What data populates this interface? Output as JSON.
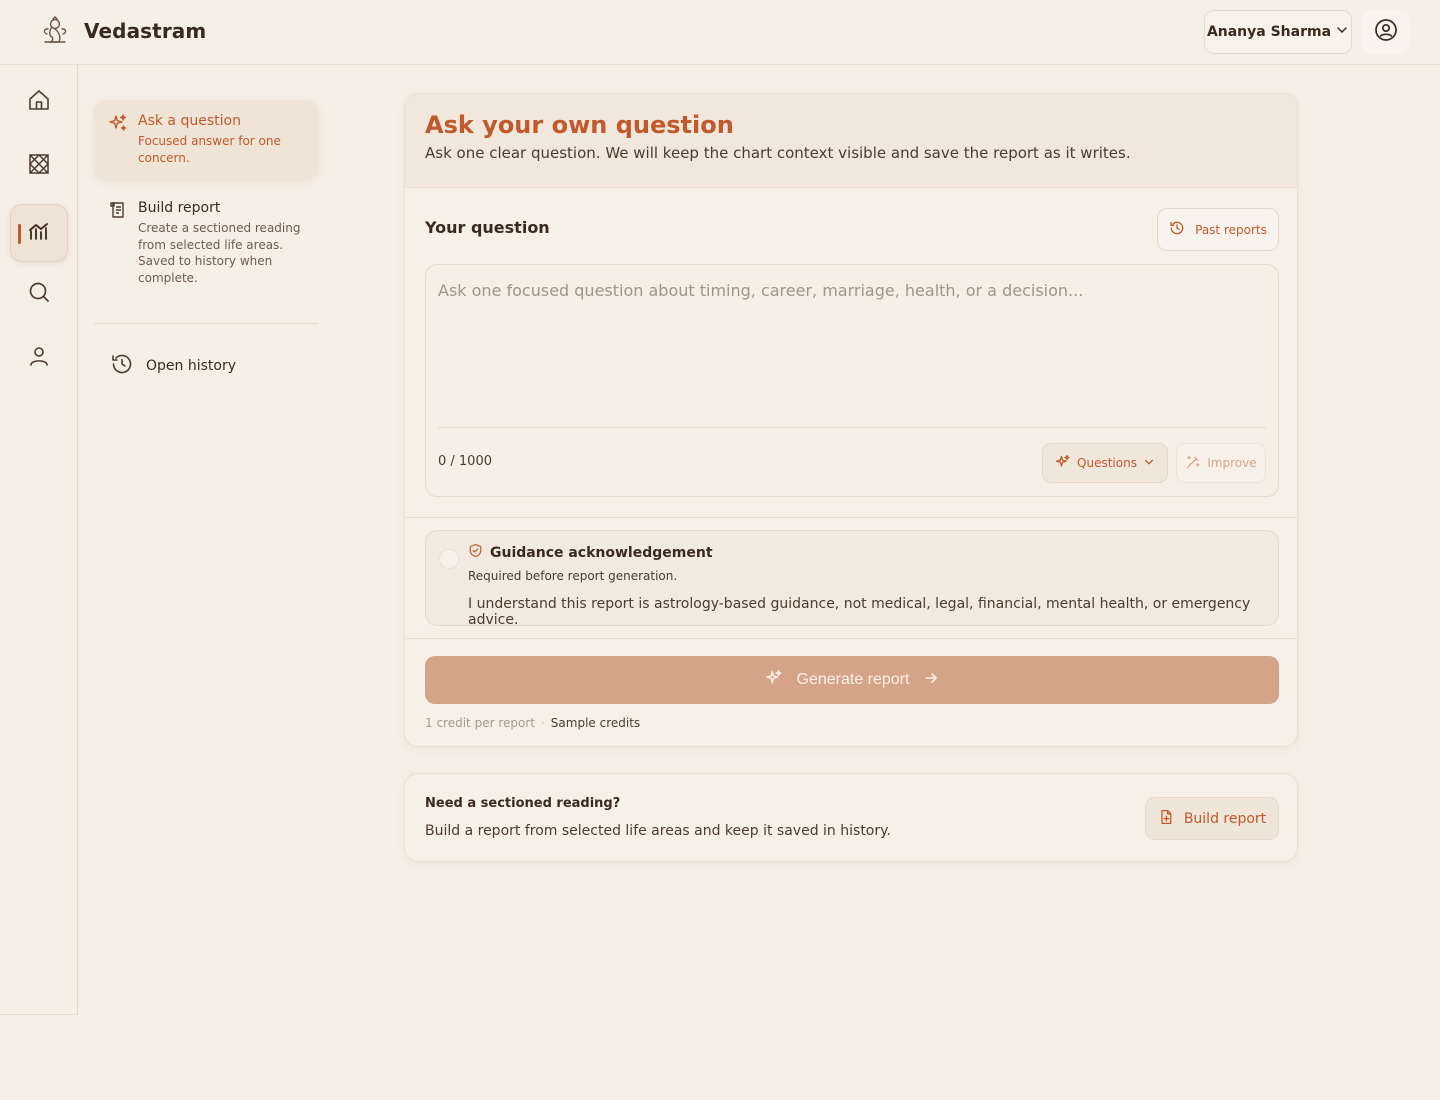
{
  "brand": {
    "name": "Vedastram"
  },
  "header": {
    "user_name": "Ananya Sharma"
  },
  "rail": {
    "items": [
      {
        "icon": "home-icon"
      },
      {
        "icon": "chart-grid-icon"
      },
      {
        "icon": "reports-icon",
        "active": true
      },
      {
        "icon": "search-icon"
      },
      {
        "icon": "profile-icon"
      }
    ]
  },
  "subnav": {
    "ask": {
      "title": "Ask a question",
      "desc": "Focused answer for one concern."
    },
    "build": {
      "title": "Build report",
      "desc": "Create a sectioned reading from selected life areas. Saved to history when complete."
    },
    "history": "Open history"
  },
  "main": {
    "title": "Ask your own question",
    "subtitle": "Ask one clear question. We will keep the chart context visible and save the report as it writes.",
    "question_label": "Your question",
    "past_reports": "Past reports",
    "input_placeholder": "Ask one focused question about timing, career, marriage, health, or a decision...",
    "input_value": "",
    "char_count": "0 / 1000",
    "questions_label": "Questions",
    "improve_label": "Improve",
    "guidance": {
      "title": "Guidance acknowledgement",
      "required": "Required before report generation.",
      "text": "I understand this report is astrology-based guidance, not medical, legal, financial, mental health, or emergency advice."
    },
    "generate_label": "Generate report",
    "credits_text": "1 credit per report",
    "credits_source": "Sample credits"
  },
  "secondary": {
    "title": "Need a sectioned reading?",
    "desc": "Build a report from selected life areas and keep it saved in history.",
    "button": "Build report"
  },
  "colors": {
    "accent": "#c0592c",
    "generate": "#d5a488",
    "background": "#f6efe6"
  }
}
